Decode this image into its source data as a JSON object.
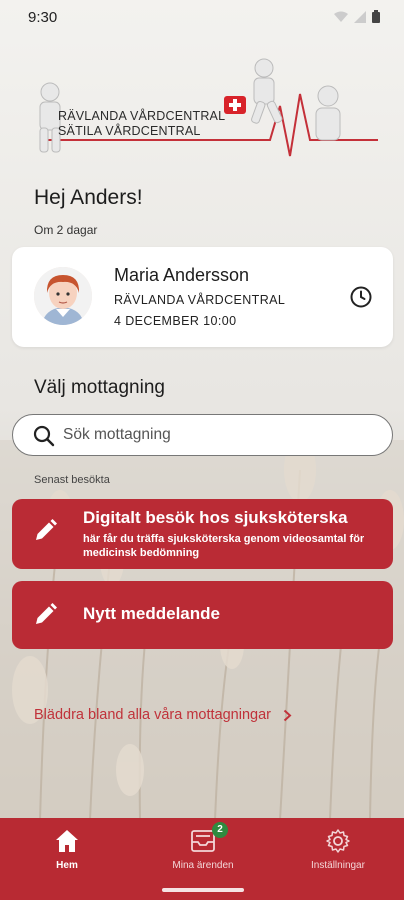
{
  "status_bar": {
    "time": "9:30"
  },
  "logo": {
    "line1": "RÄVLANDA VÅRDCENTRAL",
    "line2": "SÄTILA VÅRDCENTRAL"
  },
  "greeting": "Hej Anders!",
  "upcoming_label": "Om 2 dagar",
  "appointment": {
    "name": "Maria Andersson",
    "clinic": "RÄVLANDA VÅRDCENTRAL",
    "date": "4 DECEMBER 10:00"
  },
  "section_title": "Välj mottagning",
  "search": {
    "placeholder": "Sök mottagning"
  },
  "recent_label": "Senast besökta",
  "services": [
    {
      "title": "Digitalt besök hos sjuksköterska",
      "description": "här får du träffa sjuksköterska genom videosamtal för medicinsk bedömning"
    },
    {
      "title": "Nytt meddelande"
    }
  ],
  "browse_link": "Bläddra bland alla våra mottagningar",
  "tabs": [
    {
      "label": "Hem",
      "icon": "home-icon",
      "active": true
    },
    {
      "label": "Mina ärenden",
      "icon": "inbox-icon",
      "badge": "2"
    },
    {
      "label": "Inställningar",
      "icon": "gear-icon"
    }
  ],
  "colors": {
    "accent": "#ba2b35",
    "tabbar": "#b82a33",
    "link": "#c0323a",
    "badge": "#2f8a3f"
  }
}
